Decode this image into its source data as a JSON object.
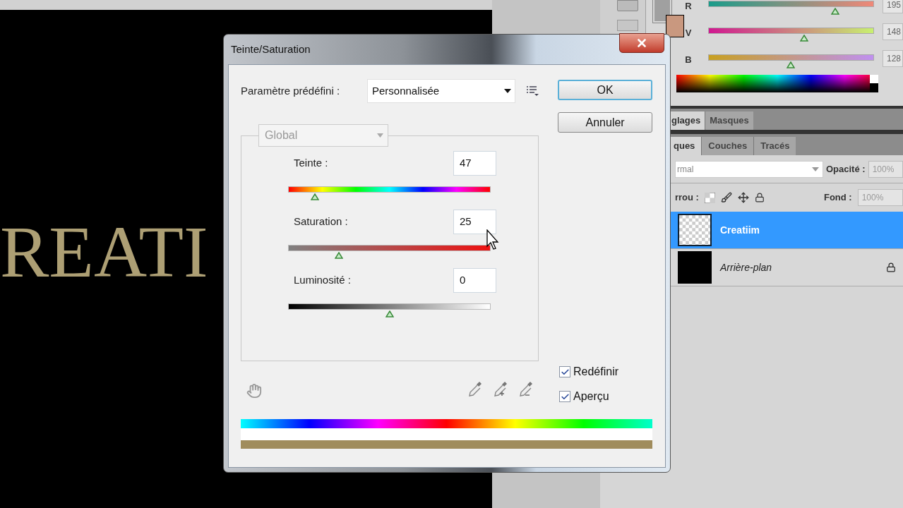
{
  "canvas": {
    "text": "REATI"
  },
  "color_panel": {
    "channels": [
      {
        "label": "R",
        "level": 0.77,
        "value": "195"
      },
      {
        "label": "V",
        "level": 0.58,
        "value": "148"
      },
      {
        "label": "B",
        "level": 0.5,
        "value": "128"
      }
    ]
  },
  "adjust_tabs": [
    {
      "label": "glages",
      "selected": true
    },
    {
      "label": "Masques",
      "selected": false
    }
  ],
  "layer_tabs": [
    {
      "label": "ques",
      "selected": true
    },
    {
      "label": "Couches",
      "selected": false
    },
    {
      "label": "Tracés",
      "selected": false
    }
  ],
  "blend_mode": "rmal",
  "opacity": {
    "label": "Opacité :",
    "value": "100%"
  },
  "lock": {
    "label": "rrou :"
  },
  "fill": {
    "label": "Fond :",
    "value": "100%"
  },
  "layers": [
    {
      "name": "Creatiim",
      "selected": true,
      "kind": "transparent",
      "locked": false
    },
    {
      "name": "Arrière-plan",
      "selected": false,
      "kind": "black",
      "locked": true
    }
  ],
  "dialog": {
    "title": "Teinte/Saturation",
    "preset_label": "Paramètre prédéfini :",
    "preset": "Personnalisée",
    "buttons": [
      "OK",
      "Annuler"
    ],
    "range": {
      "value": "Global",
      "disabled": true
    },
    "sliders": [
      {
        "label": "Teinte :",
        "value": "47",
        "kind": "hue",
        "level": 0.13
      },
      {
        "label": "Saturation :",
        "value": "25",
        "kind": "saturation",
        "level": 0.25
      },
      {
        "label": "Luminosité :",
        "value": "0",
        "kind": "lightness",
        "level": 0.5
      }
    ],
    "checkboxes": [
      {
        "label": "Redéfinir",
        "checked": true
      },
      {
        "label": "Aperçu",
        "checked": true
      }
    ]
  }
}
